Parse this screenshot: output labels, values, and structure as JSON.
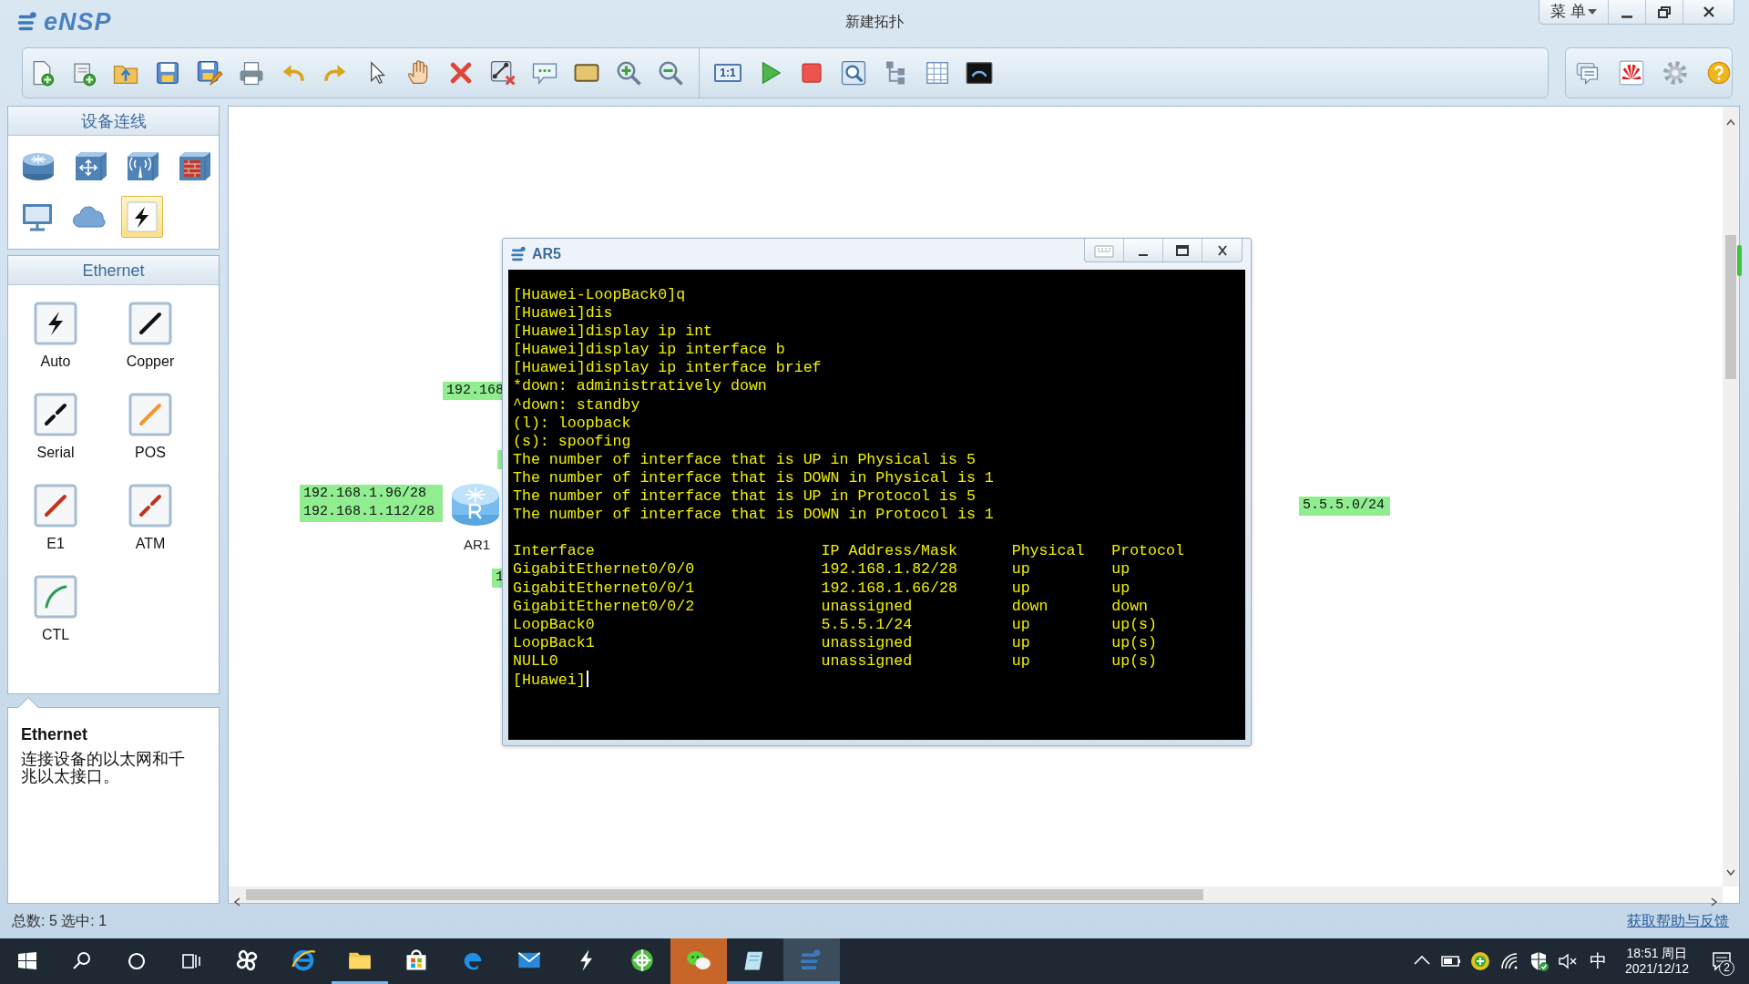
{
  "window": {
    "app_name": "eNSP",
    "title": "新建拓扑",
    "menu_label": "菜 单"
  },
  "toolbar": {
    "zoom_reset_label": "1:1"
  },
  "sidebar": {
    "section_title": "设备连线",
    "device_types": [
      {
        "selected": false
      },
      {
        "selected": false
      },
      {
        "selected": false
      },
      {
        "selected": false
      },
      {
        "selected": false
      },
      {
        "selected": false
      },
      {
        "selected": true
      }
    ],
    "link_section_title": "Ethernet",
    "links": [
      {
        "label": "Auto",
        "kind": "bolt",
        "color": "#111111"
      },
      {
        "label": "Copper",
        "kind": "solid",
        "color": "#111111"
      },
      {
        "label": "Serial",
        "kind": "dashed",
        "color": "#111111"
      },
      {
        "label": "POS",
        "kind": "solid",
        "color": "#f5962a"
      },
      {
        "label": "E1",
        "kind": "solid",
        "color": "#c0341b"
      },
      {
        "label": "ATM",
        "kind": "dashed",
        "color": "#c0341b"
      },
      {
        "label": "CTL",
        "kind": "curve",
        "color": "#2e9a5a"
      }
    ],
    "info": {
      "title": "Ethernet",
      "description": "连接设备的以太网和千兆以太接口。"
    }
  },
  "canvas": {
    "labels": [
      {
        "lines": [
          "192.168"
        ]
      },
      {
        "lines": [
          "192.168.1.96/28",
          "192.168.1.112/28"
        ]
      },
      {
        "lines": [
          "1"
        ]
      },
      {
        "lines": [
          "5.5.5.0/24"
        ]
      }
    ],
    "devices": [
      {
        "name": "AR1"
      }
    ]
  },
  "terminal": {
    "title": "AR5",
    "blocks": [
      [
        "[Huawei-LoopBack0]q",
        "[Huawei]dis",
        "[Huawei]display ip int",
        "[Huawei]display ip interface b",
        "[Huawei]display ip interface brief",
        "*down: administratively down",
        "^down: standby",
        "(l): loopback",
        "(s): spoofing",
        "The number of interface that is UP in Physical is 5",
        "The number of interface that is DOWN in Physical is 1",
        "The number of interface that is UP in Protocol is 5",
        "The number of interface that is DOWN in Protocol is 1"
      ],
      [
        "Interface                         IP Address/Mask      Physical   Protocol",
        "GigabitEthernet0/0/0              192.168.1.82/28      up         up",
        "GigabitEthernet0/0/1              192.168.1.66/28      up         up",
        "GigabitEthernet0/0/2              unassigned           down       down",
        "LoopBack0                         5.5.5.1/24           up         up(s)",
        "LoopBack1                         unassigned           up         up(s)",
        "NULL0                             unassigned           up         up(s)"
      ]
    ],
    "prompt": "[Huawei]"
  },
  "status_bar": {
    "summary": "总数: 5 选中: 1",
    "help_link": "获取帮助与反馈"
  },
  "taskbar": {
    "apps": [
      {
        "running": false,
        "flashing": false,
        "selected": false
      },
      {
        "running": false,
        "flashing": false,
        "selected": false
      },
      {
        "running": true,
        "flashing": false,
        "selected": false
      },
      {
        "running": false,
        "flashing": false,
        "selected": false
      },
      {
        "running": false,
        "flashing": false,
        "selected": false
      },
      {
        "running": false,
        "flashing": false,
        "selected": false
      },
      {
        "running": false,
        "flashing": false,
        "selected": false
      },
      {
        "running": false,
        "flashing": false,
        "selected": false
      },
      {
        "running": false,
        "flashing": true,
        "selected": false
      },
      {
        "running": true,
        "flashing": false,
        "selected": false
      },
      {
        "running": true,
        "flashing": false,
        "selected": true
      }
    ],
    "tray": {
      "ime": "中",
      "time": "18:51 周日",
      "date": "2021/12/12",
      "notifications": "2"
    }
  }
}
